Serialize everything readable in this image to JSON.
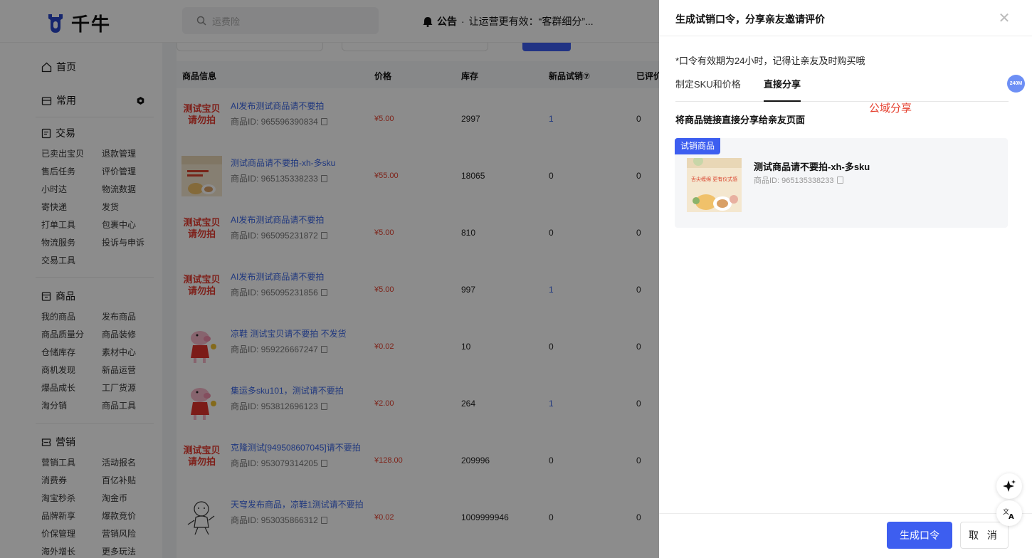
{
  "app": {
    "logo_text": "千牛"
  },
  "search": {
    "placeholder": "运费险"
  },
  "notice": {
    "label": "公告",
    "text": "让运营更有效：“客群细分”..."
  },
  "sidebar": {
    "home": "首页",
    "common": "常用",
    "sections": [
      {
        "title": "交易",
        "items": [
          "已卖出宝贝",
          "退款管理",
          "售后任务",
          "评价管理",
          "小时达",
          "物流数据",
          "寄快递",
          "发货",
          "打单工具",
          "包裹中心",
          "物流服务",
          "投诉与申诉",
          "交易工具"
        ]
      },
      {
        "title": "商品",
        "items": [
          "我的商品",
          "发布商品",
          "商品质量分",
          "商品装修",
          "仓储库存",
          "素材中心",
          "商机发现",
          "新品运营",
          "爆品成长",
          "工厂货源",
          "淘分销",
          "商品工具"
        ]
      },
      {
        "title": "营销",
        "items": [
          "营销工具",
          "活动报名",
          "消费券",
          "百亿补贴",
          "淘宝秒杀",
          "淘金币",
          "品牌新享",
          "爆款竞价",
          "价保管理",
          "营销风险",
          "海外增长",
          "更多玩法"
        ]
      }
    ]
  },
  "table": {
    "headers": [
      "商品信息",
      "价格",
      "库存",
      "新品试销⑦",
      "已评价"
    ],
    "rows": [
      {
        "thumb": "text",
        "thumb_text": "测试宝贝请勿拍",
        "title": "AI发布测试商品请不要拍",
        "id": "商品ID: 965596390834",
        "price": "¥5.00",
        "stock": "2997",
        "trial": "1",
        "done": "0"
      },
      {
        "thumb": "food",
        "title": "测试商品请不要拍-xh-多sku",
        "id": "商品ID: 965135338233",
        "price": "¥55.00",
        "stock": "18065",
        "trial": "0",
        "done": "0"
      },
      {
        "thumb": "text",
        "thumb_text": "测试宝贝请勿拍",
        "title": "AI发布测试商品请不要拍",
        "id": "商品ID: 965095231872",
        "price": "¥5.00",
        "stock": "810",
        "trial": "0",
        "done": "0"
      },
      {
        "thumb": "text",
        "thumb_text": "测试宝贝请勿拍",
        "title": "AI发布测试商品请不要拍",
        "id": "商品ID: 965095231856",
        "price": "¥5.00",
        "stock": "997",
        "trial": "1",
        "done": "0"
      },
      {
        "thumb": "pig",
        "title": "凉鞋 测试宝贝请不要拍 不发货",
        "id": "商品ID: 959226667247",
        "price": "¥0.02",
        "stock": "10",
        "trial": "0",
        "done": "0"
      },
      {
        "thumb": "pig",
        "title": "集运多sku101，测试请不要拍",
        "id": "商品ID: 953812696123",
        "price": "¥2.00",
        "stock": "264",
        "trial": "1",
        "done": "0"
      },
      {
        "thumb": "text",
        "thumb_text": "测试宝贝请勿拍",
        "title": "克隆测试[949508607045]请不要拍",
        "id": "商品ID: 953079314205",
        "price": "¥128.00",
        "stock": "209996",
        "trial": "0",
        "done": "0"
      },
      {
        "thumb": "sketch",
        "title": "天穹发布商品，凉鞋1测试请不要拍",
        "id": "商品ID: 953035866312",
        "price": "¥0.02",
        "stock": "1009999946",
        "trial": "0",
        "done": "0"
      }
    ]
  },
  "drawer": {
    "title": "生成试销口令，分享亲友邀请评价",
    "hint": "*口令有效期为24小时，记得让亲友及时购买哦",
    "tabs": [
      "制定SKU和价格",
      "直接分享"
    ],
    "active_tab": 1,
    "annotation": "公域分享",
    "section_title": "将商品链接直接分享给亲友页面",
    "product": {
      "tag": "试销商品",
      "name": "测试商品请不要拍-xh-多sku",
      "id": "商品ID: 965135338233",
      "image_caption": "舌尖缠绵 更有仪式感"
    },
    "primary_button": "生成口令",
    "cancel_button": "取 消"
  },
  "float": {
    "badge": "240M"
  },
  "colors": {
    "primary": "#3d5ef0",
    "price": "#e5402f",
    "link": "#3b66e6",
    "annotation": "#e5402f"
  }
}
